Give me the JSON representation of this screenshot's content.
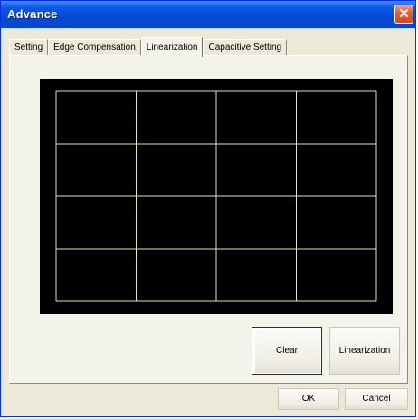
{
  "window": {
    "title": "Advance",
    "close_label": "✕"
  },
  "tabs": [
    {
      "label": "Setting",
      "active": false
    },
    {
      "label": "Edge Compensation",
      "active": false
    },
    {
      "label": "Linearization",
      "active": true
    },
    {
      "label": "Capacitive Setting",
      "active": false
    }
  ],
  "linearization_panel": {
    "grid_columns": 4,
    "grid_rows": 4,
    "background_color": "#000000",
    "grid_color": "#e8e4a8",
    "clear_label": "Clear",
    "linearization_label": "Linearization"
  },
  "footer": {
    "ok_label": "OK",
    "cancel_label": "Cancel"
  }
}
